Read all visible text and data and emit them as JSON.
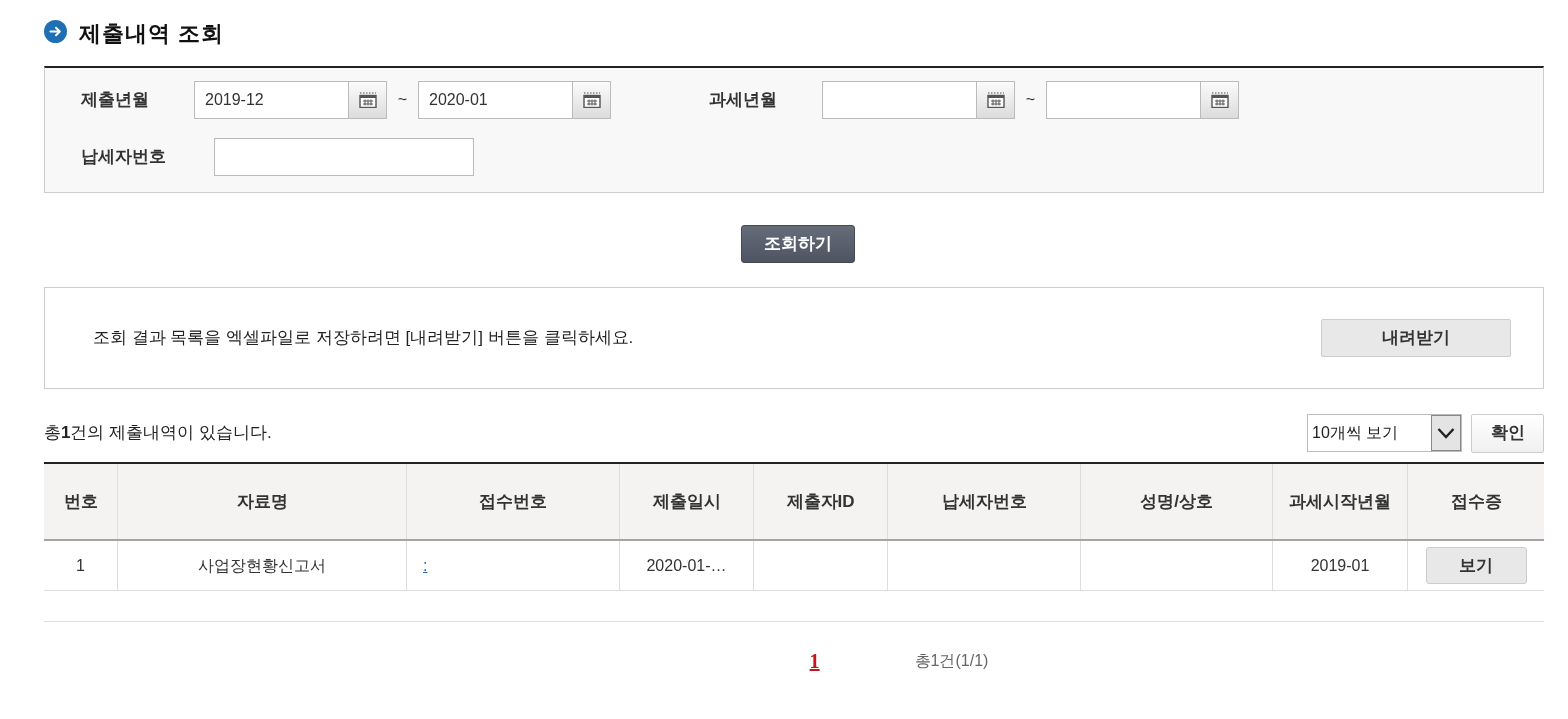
{
  "page_title": "제출내역 조회",
  "search_form": {
    "date_ranges": [
      {
        "label": "제출년월",
        "from": "2019-12",
        "separator": "~",
        "to": "2020-01"
      },
      {
        "label": "과세년월",
        "separator": "~"
      }
    ],
    "taxpayer_number": {
      "label": "납세자번호"
    }
  },
  "search_button": "조회하기",
  "download_panel": {
    "message": "조회 결과 목록을 엑셀파일로 저장하려면 [내려받기] 버튼을 클릭하세요.",
    "button": "내려받기"
  },
  "result_summary": "총**1**건의 제출내역이 있습니다.",
  "page_size": {
    "value": "10개씩 보기"
  },
  "confirm_button": "확인",
  "table": {
    "columns": [
      "번호",
      "자료명",
      "접수번호",
      "제출일시",
      "제출자ID",
      "납세자번호",
      "성명/상호",
      "과세시작년월",
      "접수증"
    ],
    "rows": [
      {
        "number": "1",
        "document_name": "사업장현황신고서",
        "receipt_number": ":",
        "submitted_at": "2020-01-…",
        "tax_start_month": "2019-01",
        "receipt_button": "보기"
      }
    ]
  },
  "pagination": {
    "pages": [
      {
        "label": "1",
        "selected": true
      }
    ],
    "summary": "총1건(1/1)"
  }
}
